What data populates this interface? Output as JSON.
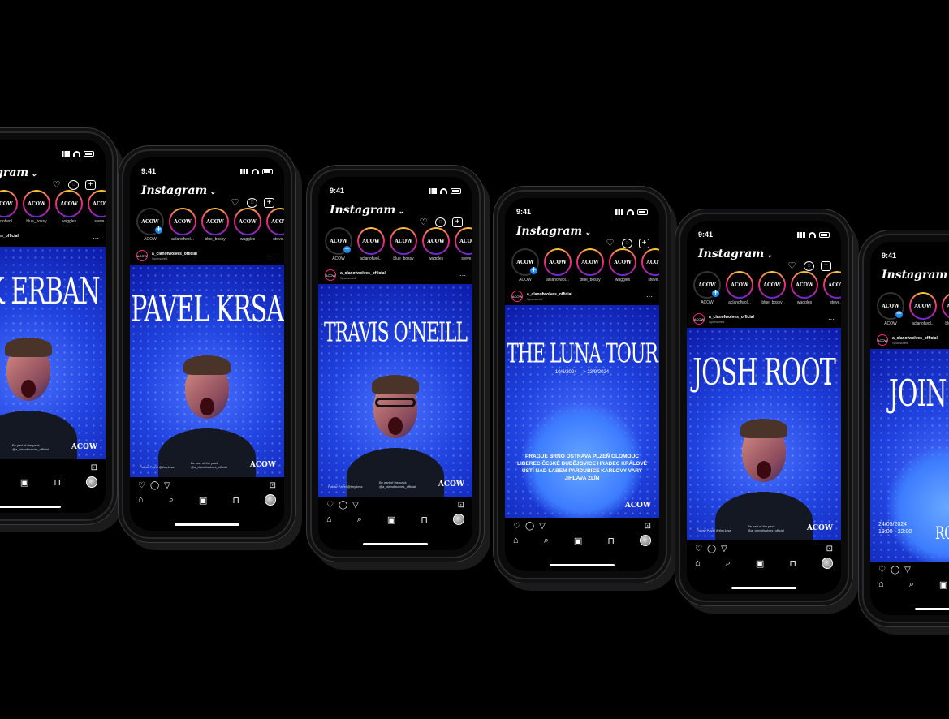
{
  "status_time": "9:41",
  "app_name": "Instagram",
  "app_chevron": "⌄",
  "brand_mark": "ACOW",
  "sponsored_account": "a_clanofwolves_official",
  "sponsored_label": "Sponsored",
  "stories": [
    {
      "name": "ACOW",
      "own": true
    },
    {
      "name": "aclanofwol...",
      "own": false
    },
    {
      "name": "blue_bossy",
      "own": false
    },
    {
      "name": "waggles",
      "own": false
    },
    {
      "name": "steve.lo",
      "own": false
    }
  ],
  "icons": {
    "heart": "♡",
    "messenger": "◌",
    "new_post": "+",
    "comment": "◯",
    "share": "▽",
    "save": "⊡",
    "home": "⌂",
    "search": "⌕",
    "reels": "▣",
    "shop": "⊓",
    "more": "···"
  },
  "phones": [
    {
      "title": "NIK ERBAN",
      "kind": "artist"
    },
    {
      "title": "PAVEL KRSA",
      "kind": "artist"
    },
    {
      "title": "TRAVIS O'NEILL",
      "kind": "artist_glasses"
    },
    {
      "title": "THE LUNA TOUR",
      "kind": "tour"
    },
    {
      "title": "JOSH ROOT",
      "kind": "artist"
    },
    {
      "title": "JOIN THE",
      "kind": "event"
    }
  ],
  "tour": {
    "dates": "10/6/2024 —> 23/9/2024",
    "cities": "PRAGUE  BRNO  OSTRAVA  PLZEŇ  OLOMOUC  LIBEREC  ČESKÉ BUDĚJOVICE  HRADEC KRÁLOVÉ  ÚSTÍ NAD LABEM  PARDUBICE  KARLOVY VARY  JIHLAVA  ZLÍN"
  },
  "event": {
    "date": "24/05/2024",
    "time": "19:00 - 22:00",
    "venue": "ROXY"
  },
  "fineprint": {
    "left": "Follow Pavel @tiny.krsa",
    "right": "Be part of the pack @a_clanofwolves_official"
  },
  "colors": {
    "background": "#000000",
    "post_blue": "#2043e0",
    "story_ring": "#ee2a7b",
    "badge_blue": "#1d8cf8"
  }
}
